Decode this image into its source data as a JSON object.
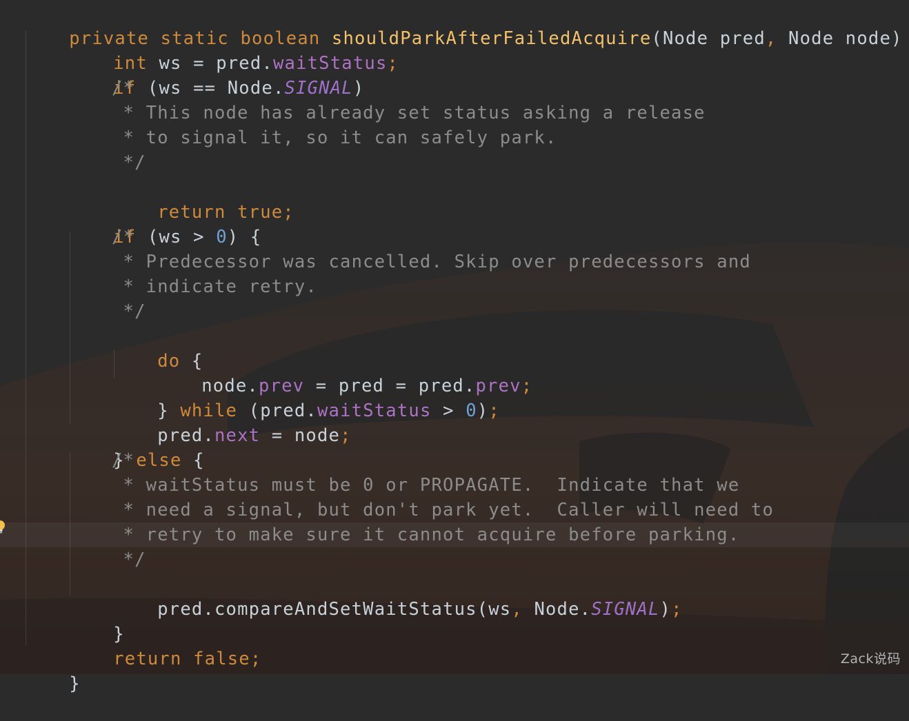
{
  "colors": {
    "background": "#2b2b2b",
    "keyword": "#d08a3c",
    "method_name": "#f3c06b",
    "field": "#ad72c4",
    "constant": "#a071c8",
    "number": "#6fa3d6",
    "comment": "#8c8c8c",
    "plain": "#c9d1d9"
  },
  "icons": {
    "gutter": "lightbulb-icon"
  },
  "watermark": "Zack说码",
  "code": {
    "l1": {
      "t1": "private static boolean ",
      "t2": "shouldParkAfterFailedAcquire",
      "t3": "(Node pred",
      "t4": ", ",
      "t5": "Node node) {"
    },
    "l2": {
      "t1": "int ",
      "t2": "ws = pred.",
      "t3": "waitStatus",
      "t4": ";"
    },
    "l3": {
      "t1": "if ",
      "t2": "(ws == Node.",
      "t3": "SIGNAL",
      "t4": ")"
    },
    "l4": {
      "t1": "/*"
    },
    "l5": {
      "t1": " * This node has already set status asking a release"
    },
    "l6": {
      "t1": " * to signal it, so it can safely park."
    },
    "l7": {
      "t1": " */"
    },
    "l8": {
      "t1": "return true;"
    },
    "l9": {
      "t1": "if ",
      "t2": "(ws > ",
      "t3": "0",
      "t4": ") {"
    },
    "l10": {
      "t1": "/*"
    },
    "l11": {
      "t1": " * Predecessor was cancelled. Skip over predecessors and"
    },
    "l12": {
      "t1": " * indicate retry."
    },
    "l13": {
      "t1": " */"
    },
    "l14": {
      "t1": "do ",
      "t2": "{"
    },
    "l15": {
      "t1": "node.",
      "t2": "prev",
      "t3": " = pred = pred.",
      "t4": "prev",
      "t5": ";"
    },
    "l16": {
      "t1": "} ",
      "t2": "while ",
      "t3": "(pred.",
      "t4": "waitStatus",
      "t5": " > ",
      "t6": "0",
      "t7": ")",
      "t8": ";"
    },
    "l17": {
      "t1": "pred.",
      "t2": "next",
      "t3": " = node",
      "t4": ";"
    },
    "l18": {
      "t1": "} ",
      "t2": "else ",
      "t3": "{"
    },
    "l19": {
      "t1": "/*"
    },
    "l20": {
      "t1": " * waitStatus must be 0 or PROPAGATE.  Indicate that we"
    },
    "l21": {
      "t1": " * need a signal, but don't park yet.  Caller will need to"
    },
    "l22": {
      "t1": " * retry to make sure it cannot acquire before parking."
    },
    "l23": {
      "t1": " */"
    },
    "l24": {
      "t1": "pred.compareAndSetWaitStatus(ws",
      "t2": ", ",
      "t3": "Node.",
      "t4": "SIGNAL",
      "t5": ")",
      "t6": ";"
    },
    "l25": {
      "t1": "}"
    },
    "l26": {
      "t1": "return false;"
    },
    "l27": {
      "t1": "}"
    }
  }
}
